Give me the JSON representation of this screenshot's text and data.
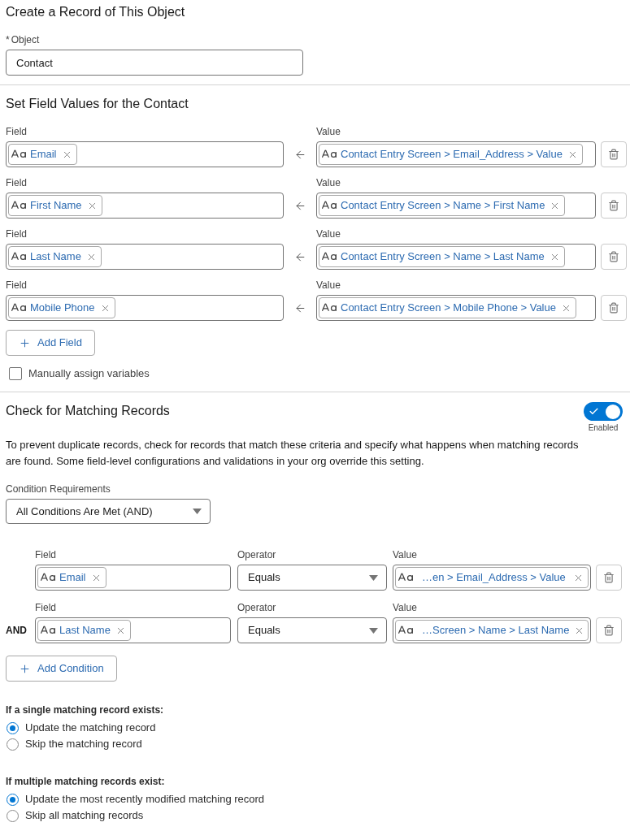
{
  "create_record": {
    "title": "Create a Record of This Object",
    "object_field": {
      "required_mark": "*",
      "label": "Object",
      "value": "Contact"
    }
  },
  "set_field_values": {
    "title": "Set Field Values for the Contact",
    "rows": [
      {
        "field_label": "Field",
        "field": "Email",
        "value_label": "Value",
        "value": "Contact Entry Screen > Email_Address > Value"
      },
      {
        "field_label": "Field",
        "field": "First Name",
        "value_label": "Value",
        "value": "Contact Entry Screen > Name > First Name"
      },
      {
        "field_label": "Field",
        "field": "Last Name",
        "value_label": "Value",
        "value": "Contact Entry Screen > Name > Last Name"
      },
      {
        "field_label": "Field",
        "field": "Mobile Phone",
        "value_label": "Value",
        "value": "Contact Entry Screen > Mobile Phone > Value"
      }
    ],
    "add_button": "Add Field",
    "manual_assign": {
      "label": "Manually assign variables",
      "checked": false
    }
  },
  "matching_records": {
    "title": "Check for Matching Records",
    "toggle": {
      "on": true,
      "label": "Enabled"
    },
    "description": "To prevent duplicate records, check for records that match these criteria and specify what happens when matching records are found. Some field-level configurations and validations in your org override this setting.",
    "condition_requirements": {
      "label": "Condition Requirements",
      "value": "All Conditions Are Met (AND)"
    },
    "conditions": [
      {
        "field_label": "Field",
        "field": "Email",
        "operator_label": "Operator",
        "operator": "Equals",
        "value_label": "Value",
        "value": "…en > Email_Address > Value"
      },
      {
        "connector": "AND",
        "field_label": "Field",
        "field": "Last Name",
        "operator_label": "Operator",
        "operator": "Equals",
        "value_label": "Value",
        "value": "…Screen > Name > Last Name"
      }
    ],
    "add_button": "Add Condition"
  },
  "outcomes": [
    {
      "heading": "If a single matching record exists:",
      "options": [
        {
          "label": "Update the matching record",
          "selected": true
        },
        {
          "label": "Skip the matching record",
          "selected": false
        }
      ]
    },
    {
      "heading": "If multiple matching records exist:",
      "options": [
        {
          "label": "Update the most recently modified matching record",
          "selected": true
        },
        {
          "label": "Skip all matching records",
          "selected": false
        }
      ]
    }
  ]
}
